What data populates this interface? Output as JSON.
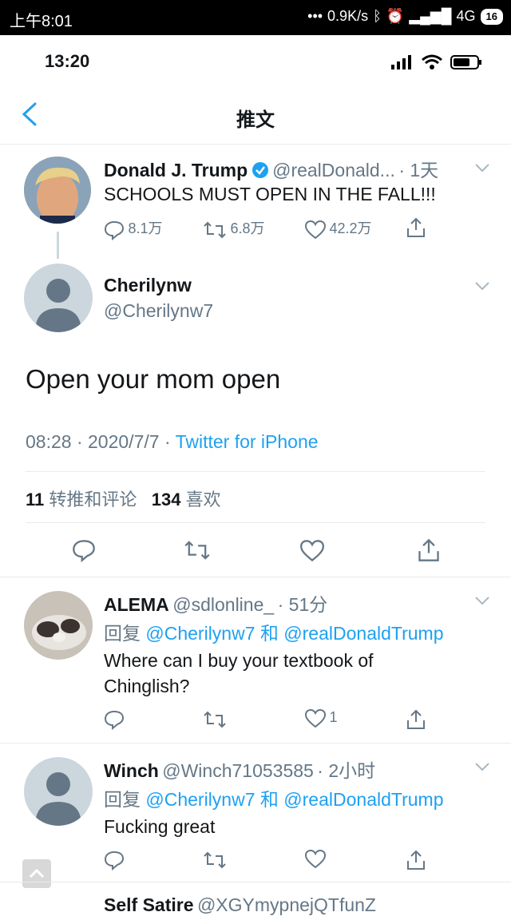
{
  "outer_status": {
    "time": "上午8:01",
    "net_speed": "0.9K/s",
    "network": "4G",
    "battery": "16"
  },
  "inner_status": {
    "time": "13:20"
  },
  "header": {
    "title": "推文"
  },
  "parent_tweet": {
    "name": "Donald J. Trump",
    "handle": "@realDonald...",
    "time": "· 1天",
    "text": "SCHOOLS MUST OPEN IN THE FALL!!!",
    "replies": "8.1万",
    "retweets": "6.8万",
    "likes": "42.2万"
  },
  "main_tweet": {
    "name": "Cherilynw",
    "handle": "@Cherilynw7",
    "text": "Open your mom open",
    "time": "08:28",
    "date": "2020/7/7",
    "source": "Twitter for iPhone",
    "retweet_count": "11",
    "retweet_label": "转推和评论",
    "like_count": "134",
    "like_label": "喜欢"
  },
  "replies": [
    {
      "name": "ALEMA",
      "handle": "@sdlonline_",
      "time": "· 51分",
      "reply_prefix": "回复",
      "reply_to_1": "@Cherilynw7",
      "reply_and": "和",
      "reply_to_2": "@realDonaldTrump",
      "text_line1": "Where can I buy your textbook of",
      "text_line2": "Chinglish?",
      "likes": "1"
    },
    {
      "name": "Winch",
      "handle": "@Winch71053585",
      "time": "· 2小时",
      "reply_prefix": "回复",
      "reply_to_1": "@Cherilynw7",
      "reply_and": "和",
      "reply_to_2": "@realDonaldTrump",
      "text_line1": "Fucking great"
    },
    {
      "name": "Self Satire",
      "handle": "@XGYmypnejQTfunZ"
    }
  ],
  "colors": {
    "accent": "#1da1f2",
    "secondary_text": "#657786",
    "divider": "#e6ecf0"
  }
}
